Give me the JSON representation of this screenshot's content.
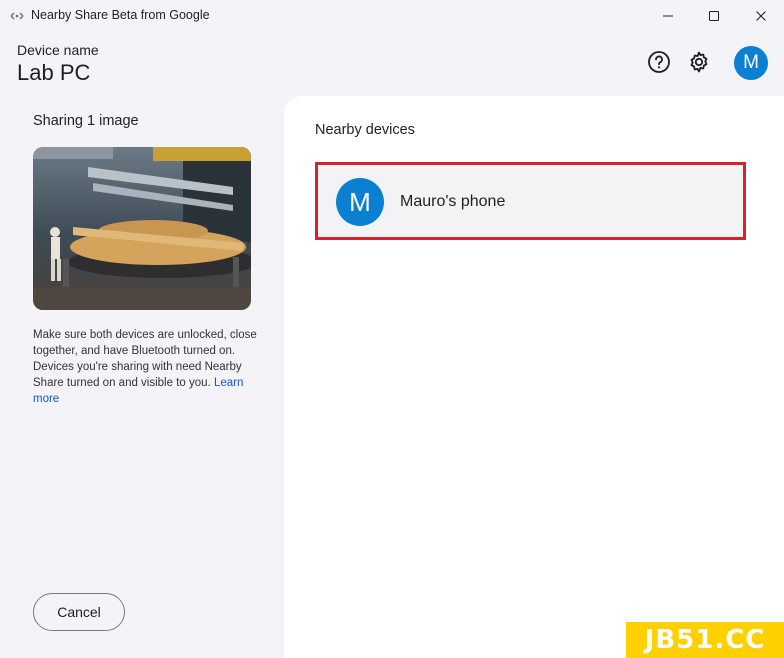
{
  "window": {
    "title": "Nearby Share Beta from Google"
  },
  "header": {
    "device_label": "Device name",
    "device_name": "Lab PC",
    "avatar_letter": "M"
  },
  "left_panel": {
    "sharing_title": "Sharing 1 image",
    "hint_text": "Make sure both devices are unlocked, close together, and have Bluetooth turned on. Devices you're sharing with need Nearby Share turned on and visible to you.",
    "learn_more": "Learn more",
    "cancel_label": "Cancel"
  },
  "right_panel": {
    "title": "Nearby devices",
    "devices": [
      {
        "avatar_letter": "M",
        "name": "Mauro's phone"
      }
    ]
  },
  "watermark": {
    "badge_text": "JB51.CC"
  },
  "colors": {
    "accent_blue": "#0b7fd1",
    "highlight_red": "#d3242b",
    "link_blue": "#0b57d0",
    "badge_yellow": "#ffd000"
  }
}
